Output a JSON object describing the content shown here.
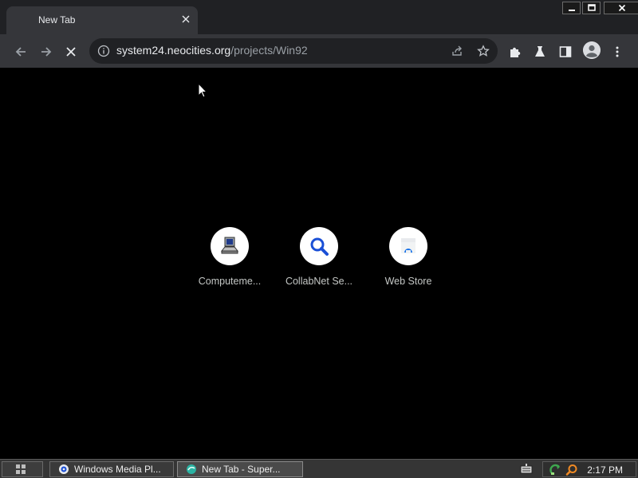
{
  "browser": {
    "tab": {
      "title": "New Tab",
      "icon": "blank-tab-icon"
    },
    "window_controls": [
      "minimize-icon",
      "maximize-icon",
      "close-icon"
    ],
    "toolbar": {
      "back_icon": "arrow-left-icon",
      "forward_icon": "arrow-right-icon",
      "stop_icon": "stop-loading-icon",
      "omnibox": {
        "host": "system24.neocities.org",
        "path": "/projects/Win92",
        "info_icon": "info-icon",
        "share_icon": "share-icon",
        "bookmark_icon": "star-icon"
      },
      "extensions_icon": "puzzle-icon",
      "labs_icon": "flask-icon",
      "side_panel_icon": "side-panel-icon",
      "profile_icon": "avatar-icon",
      "menu_icon": "kebab-menu-icon"
    }
  },
  "new_tab": {
    "shortcuts": [
      {
        "label": "Computeme...",
        "icon": "computer-icon"
      },
      {
        "label": "CollabNet Se...",
        "icon": "magnifier-icon"
      },
      {
        "label": "Web Store",
        "icon": "web-store-icon"
      }
    ]
  },
  "taskbar": {
    "start_icon": "start-grid-icon",
    "tasks": [
      {
        "label": "Windows Media Pl...",
        "icon": "media-player-icon",
        "active": false
      },
      {
        "label": "New Tab - Super...",
        "icon": "browser-icon",
        "active": true
      }
    ],
    "tray": {
      "keyboard_icon": "keyboard-icon",
      "network_icon": "network-icon",
      "search_icon": "search-icon",
      "clock": "2:17 PM"
    }
  },
  "colors": {
    "tab_strip": "#202124",
    "toolbar": "#35363a",
    "omnibox": "#202124",
    "content_bg": "#000000",
    "taskbar": "#353535"
  }
}
